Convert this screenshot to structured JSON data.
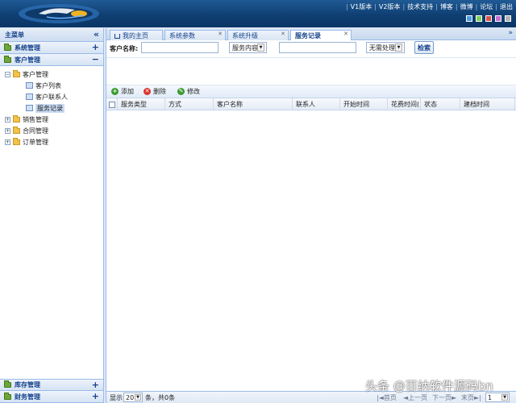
{
  "header": {
    "nav": [
      "V1版本",
      "V2版本",
      "技术支持",
      "博客",
      "微博",
      "论坛",
      "退出"
    ],
    "theme_colors": [
      "#4a9ee0",
      "#7fcf5a",
      "#e0524a",
      "#c86fd1",
      "#b3b3b3"
    ]
  },
  "sidebar": {
    "title": "主菜单",
    "collapse_icon": "«",
    "sections": {
      "system": "系统管理",
      "customer": "客户管理",
      "inventory": "库存管理",
      "finance": "财务管理"
    },
    "tree": {
      "customer_mgmt": "客户管理",
      "customer_list": "客户列表",
      "customer_contacts": "客户联系人",
      "service_records": "服务记录",
      "sales_mgmt": "销售管理",
      "contract_mgmt": "合同管理",
      "order_mgmt": "订单管理"
    }
  },
  "tabs": [
    {
      "label": "我的主页"
    },
    {
      "label": "系统参数"
    },
    {
      "label": "系统升级"
    },
    {
      "label": "服务记录"
    }
  ],
  "search": {
    "customer_name_label": "客户名称:",
    "customer_name_value": "",
    "field_select": "服务内容",
    "keyword_value": "",
    "status_select": "无需处理",
    "search_button": "检索"
  },
  "toolbar": {
    "add": "添加",
    "delete": "删除",
    "edit": "修改"
  },
  "grid": {
    "columns": [
      "服务类型",
      "方式",
      "客户名称",
      "联系人",
      "开始时间",
      "花费时间(",
      "状态",
      "建档时间"
    ]
  },
  "pager": {
    "show_label": "显示",
    "page_size": "20",
    "summary": "条，共0条",
    "first": "首页",
    "prev": "上一页",
    "next": "下一页",
    "last": "末页",
    "page_number": "1"
  },
  "watermark": "头条 @百纳软件源码bn"
}
